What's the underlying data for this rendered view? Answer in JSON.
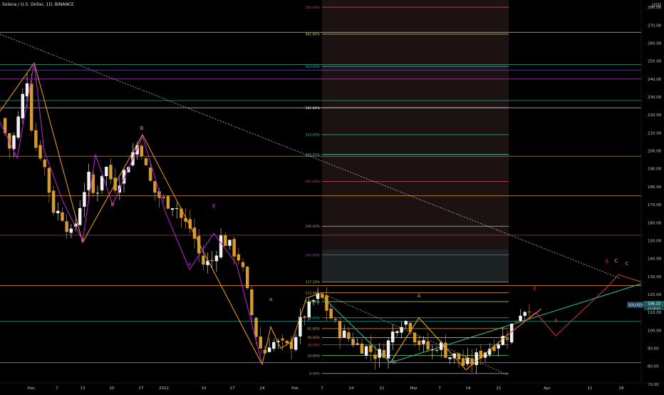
{
  "header": {
    "title": "Solana / U.S. Dollar, 1D, BINANCE",
    "currency": "USD"
  },
  "price_label": {
    "symbol": "SOLUSD",
    "price": "106.10",
    "countdown": "23:29:00"
  },
  "chart_data": {
    "type": "candlestick",
    "x_tick_labels": [
      "Dec",
      "7",
      "13",
      "20",
      "27",
      "2022",
      "10",
      "17",
      "24",
      "Feb",
      "7",
      "14",
      "21",
      "Mar",
      "7",
      "14",
      "21",
      "Apr",
      "11",
      "18"
    ],
    "y_tick_labels": [
      "70.00",
      "80.00",
      "90.00",
      "100.00",
      "110.00",
      "120.00",
      "130.00",
      "140.00",
      "150.00",
      "160.00",
      "170.00",
      "180.00",
      "190.00",
      "200.00",
      "210.00",
      "220.00",
      "230.00",
      "240.00",
      "250.00",
      "260.00",
      "270.00",
      "280.00"
    ],
    "ylim": [
      66,
      284
    ],
    "colors": {
      "up_candle": "#f2f2f2",
      "down_candle": "#d79a2e",
      "wave_purple": "#b024c8",
      "wave_orange": "#f7a21b",
      "wave_teal": "#2ebfb0",
      "projection_red": "#e53935",
      "trendline": "#aaaaaa",
      "fib_zone": "#332020"
    },
    "fib_levels": [
      {
        "label": "550.00%",
        "value": 280,
        "color": "#d0455c"
      },
      {
        "label": "461.80%",
        "value": 265,
        "color": "#e0c070"
      },
      {
        "label": "423.60%",
        "value": 247,
        "color": "#2ebfb0"
      },
      {
        "label": "361.80%",
        "value": 224,
        "color": "#f0f0f0"
      },
      {
        "label": "323.60%",
        "value": 209,
        "color": "#2ebfb0"
      },
      {
        "label": "300.00%",
        "value": 198,
        "color": "#2ebfb0"
      },
      {
        "label": "261.80%",
        "value": 183,
        "color": "#d0455c"
      },
      {
        "label": "200.00%",
        "value": 158,
        "color": "#a0a0a0"
      },
      {
        "label": "161.80%",
        "value": 142,
        "color": "#b03fcf"
      },
      {
        "label": "127.20%",
        "value": 127,
        "color": "#7fcf6a"
      },
      {
        "label": "113.00%",
        "value": 121,
        "color": "#e0a040"
      },
      {
        "label": "100.00%",
        "value": 116,
        "color": "#7fcf6a"
      },
      {
        "label": "78.60%",
        "value": 107,
        "color": "#2ebfb0"
      },
      {
        "label": "61.80%",
        "value": 101,
        "color": "#e0a040"
      },
      {
        "label": "50.00%",
        "value": 96,
        "color": "#e0a040"
      },
      {
        "label": "38.20%",
        "value": 92,
        "color": "#d0455c"
      },
      {
        "label": "23.60%",
        "value": 86,
        "color": "#7fcf6a"
      },
      {
        "label": "0.00%",
        "value": 76,
        "color": "#a0a0a0"
      }
    ],
    "wave_labels": [
      {
        "text": "B",
        "color": "#f7a21b"
      },
      {
        "text": "A",
        "color": "#f7a21b"
      },
      {
        "text": "C",
        "color": "#b024c8"
      },
      {
        "text": "A",
        "color": "#b024c8"
      },
      {
        "text": "B",
        "color": "#b024c8"
      },
      {
        "text": "b",
        "color": "#f7a21b"
      },
      {
        "text": "a",
        "color": "#f7a21b"
      },
      {
        "text": "b",
        "color": "#f7a21b"
      },
      {
        "text": "a",
        "color": "#b024c8"
      },
      {
        "text": "A",
        "color": "#f7a21b"
      },
      {
        "text": "B",
        "color": "#2ebfb0"
      },
      {
        "text": "B",
        "color": "#f7a21b"
      },
      {
        "text": "3",
        "color": "#e53935"
      },
      {
        "text": "4",
        "color": "#e53935"
      },
      {
        "text": "5",
        "color": "#e53935"
      },
      {
        "text": "C",
        "color": "#f7a21b"
      },
      {
        "text": "C",
        "color": "#2ebfb0"
      }
    ]
  }
}
